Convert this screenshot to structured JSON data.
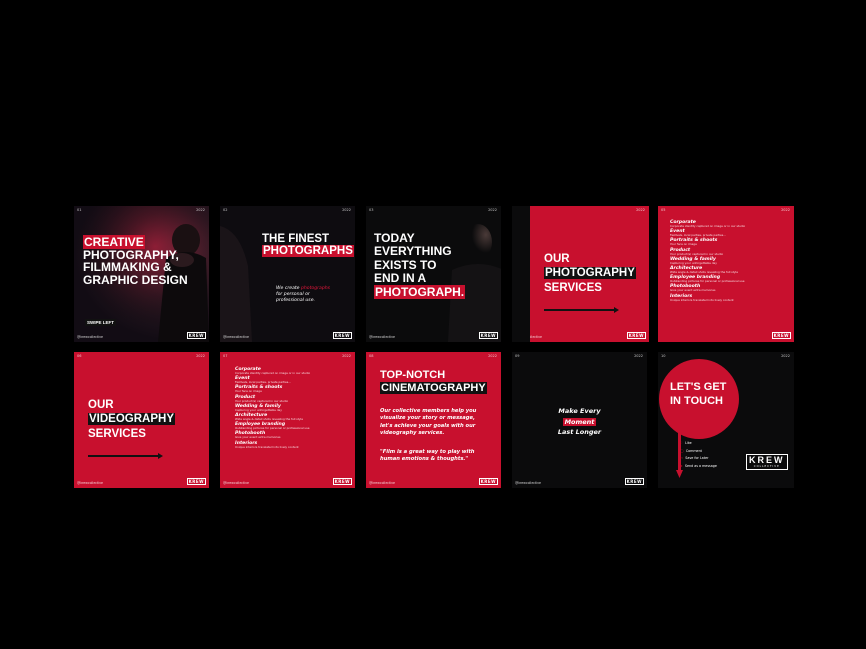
{
  "colors": {
    "brand_red": "#c8102e",
    "dark": "#0b0b0c",
    "background": "#000000"
  },
  "slides": {
    "s1": {
      "index": "01",
      "year": "2022",
      "handle": "@krewcollective",
      "logo": "KREW",
      "line1": "CREATIVE",
      "line2": "PHOTOGRAPHY,",
      "line3": "FILMMAKING &",
      "line4": "GRAPHIC DESIGN",
      "swipe": "SWIPE LEFT"
    },
    "s2": {
      "index": "02",
      "year": "2022",
      "handle": "@krewcollective",
      "logo": "KREW",
      "line1": "THE FINEST",
      "line2": "PHOTOGRAPHS",
      "body_pre": "We create ",
      "body_hl": "photographs",
      "body_post": "for personal or professional use."
    },
    "s3": {
      "index": "03",
      "year": "2022",
      "handle": "@krewcollective",
      "logo": "KREW",
      "line1": "TODAY",
      "line2": "EVERYTHING",
      "line3": "EXISTS TO",
      "line4": "END IN A",
      "line5": "PHOTOGRAPH."
    },
    "s4": {
      "index": "04",
      "year": "2022",
      "handle": "@krewcollective",
      "logo": "KREW",
      "line1": "OUR",
      "line2": "PHOTOGRAPHY",
      "line3": "SERVICES"
    },
    "s5": {
      "index": "05",
      "year": "2022",
      "logo": "KREW",
      "services": [
        {
          "name": "Corporate",
          "desc": "Corporate identity captured on image or in our studio"
        },
        {
          "name": "Event",
          "desc": "Festivals, local parties, private parties..."
        },
        {
          "name": "Portraits & shoots",
          "desc": "Your face on image"
        },
        {
          "name": "Product",
          "desc": "Your product(s) captured in our studio"
        },
        {
          "name": "Wedding & family",
          "desc": "Capturing your unforgettable day"
        },
        {
          "name": "Architecture",
          "desc": "Wide angle & detail shots revealing the full style"
        },
        {
          "name": "Employee branding",
          "desc": "Outstanding pictures for personal or professional use"
        },
        {
          "name": "Photobooth",
          "desc": "Give your event extra memories"
        },
        {
          "name": "Interiors",
          "desc": "Unique interiors translated into lively content"
        }
      ]
    },
    "s6": {
      "index": "06",
      "year": "2022",
      "handle": "@krewcollective",
      "logo": "KREW",
      "line1": "OUR",
      "line2": "VIDEOGRAPHY",
      "line3": "SERVICES"
    },
    "s7": {
      "index": "07",
      "year": "2022",
      "handle": "@krewcollective",
      "logo": "KREW",
      "services": [
        {
          "name": "Corporate",
          "desc": "Corporate identity captured on image or in our studio"
        },
        {
          "name": "Event",
          "desc": "Festivals, local parties, private parties..."
        },
        {
          "name": "Portraits & shoots",
          "desc": "Your face on image"
        },
        {
          "name": "Product",
          "desc": "Your product(s) captured in our studio"
        },
        {
          "name": "Wedding & family",
          "desc": "Capturing your unforgettable day"
        },
        {
          "name": "Architecture",
          "desc": "Wide angle & detail shots revealing the full style"
        },
        {
          "name": "Employee branding",
          "desc": "Outstanding pictures for personal or professional use"
        },
        {
          "name": "Photobooth",
          "desc": "Give your event extra memories"
        },
        {
          "name": "Interiors",
          "desc": "Unique interiors translated into lively content"
        }
      ]
    },
    "s8": {
      "index": "08",
      "year": "2022",
      "handle": "@krewcollective",
      "logo": "KREW",
      "line1": "TOP-NOTCH",
      "line2": "CINEMATOGRAPHY",
      "body": "Our collective members help you visualize your story or message, let's achieve your goals with our videography services.",
      "quote": "\"Film is a great way to play with human emotions & thoughts.\""
    },
    "s9": {
      "index": "09",
      "year": "2022",
      "handle": "@krewcollective",
      "logo": "KREW",
      "line1": "Make Every",
      "line2": "Moment",
      "line3": "Last Longer"
    },
    "s10": {
      "index": "10",
      "year": "2022",
      "line1": "LET'S GET",
      "line2": "IN TOUCH",
      "brand": "KREW",
      "brand_sub": "COLLECTIVE",
      "actions": [
        "Like",
        "Comment",
        "Save for Later",
        "Send as a message"
      ]
    }
  }
}
